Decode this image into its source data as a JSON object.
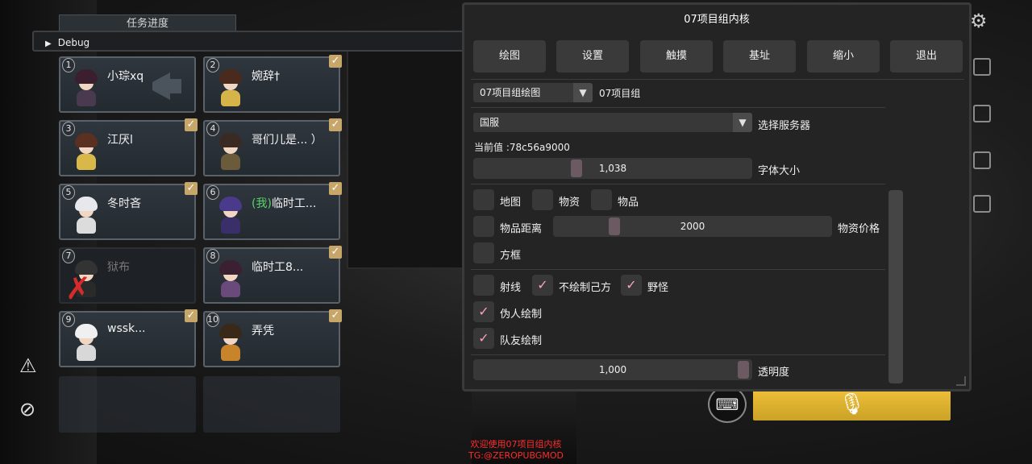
{
  "task_tab": "任务进度",
  "debug_label": "Debug",
  "players": [
    {
      "num": "1",
      "name": "小琮xq",
      "checked": false,
      "speaker": true,
      "hair": "#3b1f2e",
      "body": "#4a3a4f"
    },
    {
      "num": "2",
      "name": "婉辞†",
      "checked": true,
      "hair": "#4a2a1c",
      "body": "#d7b44a"
    },
    {
      "num": "3",
      "name": "江厌l",
      "checked": true,
      "hair": "#5a3020",
      "body": "#d9b84a"
    },
    {
      "num": "4",
      "name": "哥们儿是... ）",
      "checked": true,
      "hair": "#3a2a24",
      "body": "#6b5b3a"
    },
    {
      "num": "5",
      "name": "冬时吝",
      "checked": true,
      "hair": "#e8e8ec",
      "body": "#dcdcdc"
    },
    {
      "num": "6",
      "name_prefix": "(我)",
      "name": "临时工...",
      "checked": true,
      "hair": "#4a3a8a",
      "body": "#3b2f6a"
    },
    {
      "num": "7",
      "name": "狱布",
      "checked": false,
      "eliminated": true,
      "hair": "#333",
      "body": "#2a2a2a"
    },
    {
      "num": "8",
      "name": "临时工8...",
      "checked": true,
      "hair": "#3a2030",
      "body": "#6a4a7a"
    },
    {
      "num": "9",
      "name": "wssk...",
      "checked": true,
      "hair": "#f0f0f0",
      "body": "#d8d8d8"
    },
    {
      "num": "10",
      "name": "弄凭",
      "checked": true,
      "hair": "#3a2818",
      "body": "#c7842a"
    }
  ],
  "menu": {
    "title": "07项目组内核",
    "buttons": [
      "绘图",
      "设置",
      "触摸",
      "基址",
      "缩小",
      "退出"
    ],
    "draw_combo": {
      "value": "07项目组绘图",
      "side_label": "07项目组"
    },
    "server_combo": {
      "value": "国服",
      "side_label": "选择服务器"
    },
    "current_value": "当前值 :78c56a9000",
    "font_slider": {
      "value": "1,038",
      "label": "字体大小",
      "fraction": 0.36
    },
    "cb_map": {
      "label": "地图",
      "checked": false
    },
    "cb_supply": {
      "label": "物资",
      "checked": false
    },
    "cb_item": {
      "label": "物品",
      "checked": false
    },
    "item_distance": {
      "label": "物品距离",
      "value": "2000",
      "label_right": "物资价格",
      "fraction": 0.2
    },
    "cb_box": {
      "label": "方框",
      "checked": false
    },
    "cb_ray": {
      "label": "射线",
      "checked": false
    },
    "cb_no_self": {
      "label": "不绘制己方",
      "checked": true
    },
    "cb_monster": {
      "label": "野怪",
      "checked": true
    },
    "cb_fake": {
      "label": "伪人绘制",
      "checked": true
    },
    "cb_team": {
      "label": "队友绘制",
      "checked": true
    },
    "opacity_slider": {
      "value": "1,000",
      "label": "透明度",
      "fraction": 1.0
    }
  },
  "footer": {
    "line1": "欢迎使用07项目组内核",
    "line2": "TG:@ZEROPUBGMOD"
  },
  "colors": {
    "accent_check": "#ff9ec4",
    "gold": "#c7a66a",
    "voice": "#f0c13a",
    "footer": "#ff2b2b"
  }
}
